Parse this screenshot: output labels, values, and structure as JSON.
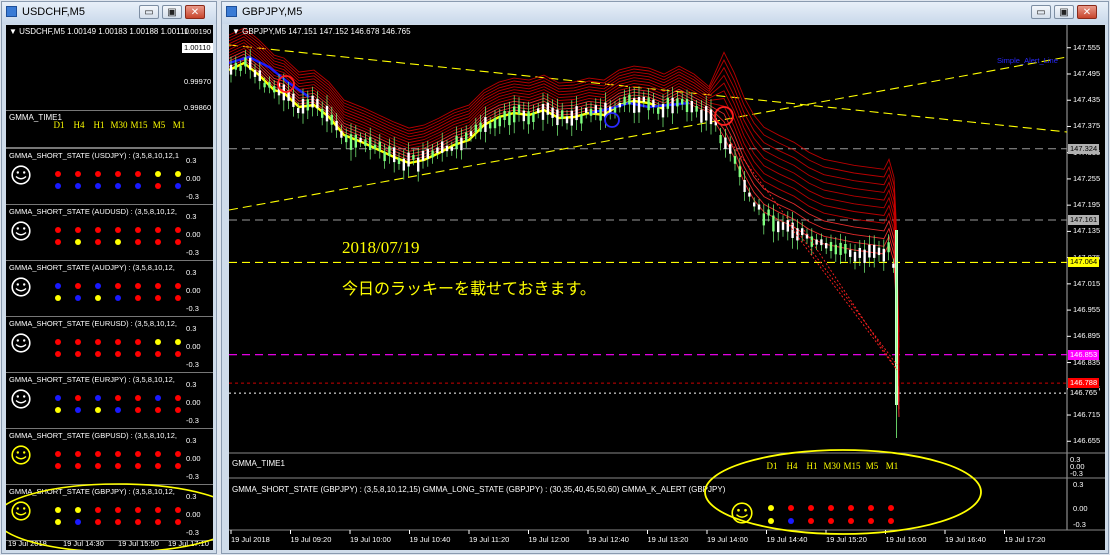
{
  "left_window": {
    "title": "USDCHF,M5",
    "minimize": "▭",
    "maximize": "▣",
    "close": "✕",
    "chart_header": "▼ USDCHF,M5  1.00149 1.00183 1.00188 1.00110",
    "price_labels": [
      "1.00190",
      "1.00110",
      "0.99970",
      "0.99860"
    ],
    "time_panel_title": "GMMA_TIME1",
    "timeframes": [
      "D1",
      "H4",
      "H1",
      "M30",
      "M15",
      "M5",
      "M1"
    ],
    "axis_labels": [
      "0.3",
      "0.00",
      "-0.3"
    ],
    "panels": [
      {
        "title": "GMMA_SHORT_STATE (USDJPY) : (3,5,8,10,12,1",
        "face": "white",
        "top_row": [
          "red",
          "red",
          "red",
          "red",
          "red",
          "yellow",
          "yellow"
        ],
        "bottom_row": [
          "blue",
          "blue",
          "blue",
          "blue",
          "blue",
          "red",
          "blue"
        ]
      },
      {
        "title": "GMMA_SHORT_STATE (AUDUSD) : (3,5,8,10,12,",
        "face": "white",
        "top_row": [
          "red",
          "red",
          "red",
          "red",
          "red",
          "red",
          "red"
        ],
        "bottom_row": [
          "red",
          "yellow",
          "red",
          "yellow",
          "red",
          "red",
          "red"
        ]
      },
      {
        "title": "GMMA_SHORT_STATE (AUDJPY) : (3,5,8,10,12,",
        "face": "white",
        "top_row": [
          "blue",
          "red",
          "blue",
          "red",
          "red",
          "red",
          "red"
        ],
        "bottom_row": [
          "yellow",
          "blue",
          "yellow",
          "blue",
          "red",
          "red",
          "red"
        ]
      },
      {
        "title": "GMMA_SHORT_STATE (EURUSD) : (3,5,8,10,12,",
        "face": "white",
        "top_row": [
          "red",
          "red",
          "red",
          "red",
          "red",
          "yellow",
          "yellow"
        ],
        "bottom_row": [
          "red",
          "red",
          "red",
          "red",
          "red",
          "red",
          "red"
        ]
      },
      {
        "title": "GMMA_SHORT_STATE (EURJPY) : (3,5,8,10,12,",
        "face": "white",
        "top_row": [
          "blue",
          "red",
          "blue",
          "red",
          "red",
          "blue",
          "red"
        ],
        "bottom_row": [
          "yellow",
          "blue",
          "yellow",
          "blue",
          "red",
          "red",
          "red"
        ]
      },
      {
        "title": "GMMA_SHORT_STATE (GBPUSD) : (3,5,8,10,12,",
        "face": "yellow",
        "top_row": [
          "red",
          "red",
          "red",
          "red",
          "red",
          "red",
          "red"
        ],
        "bottom_row": [
          "red",
          "red",
          "red",
          "red",
          "red",
          "red",
          "red"
        ]
      },
      {
        "title": "GMMA_SHORT_STATE (GBPJPY) : (3,5,8,10,12,",
        "face": "yellow",
        "top_row": [
          "yellow",
          "yellow",
          "red",
          "red",
          "red",
          "red",
          "red"
        ],
        "bottom_row": [
          "yellow",
          "blue",
          "red",
          "red",
          "red",
          "red",
          "red"
        ]
      }
    ],
    "time_labels": [
      "19 Jul 2018",
      "19 Jul 14:30",
      "19 Jul 15:50",
      "19 Jul 17:10"
    ]
  },
  "main_window": {
    "title": "GBPJPY,M5",
    "minimize": "▭",
    "maximize": "▣",
    "close": "✕",
    "chart_header": "▼ GBPJPY,M5  147.151 147.152 146.678 146.765",
    "indicator_label": "Simple_Alert_Line",
    "annotation_date": "2018/07/19",
    "annotation_text": "今日のラッキーを載せておきます。",
    "price_ticks": [
      "147.555",
      "147.495",
      "147.435",
      "147.375",
      "147.315",
      "147.255",
      "147.195",
      "147.135",
      "147.075",
      "147.015",
      "146.955",
      "146.895",
      "146.835",
      "146.775",
      "146.715",
      "146.655"
    ],
    "price_markers": [
      {
        "label": "147.324",
        "bg": "#b0b0b0",
        "fg": "#000000"
      },
      {
        "label": "147.161",
        "bg": "#b0b0b0",
        "fg": "#000000"
      },
      {
        "label": "147.064",
        "bg": "#ffff00",
        "fg": "#000000"
      },
      {
        "label": "146.853",
        "bg": "#ff00ff",
        "fg": "#ffffff"
      },
      {
        "label": "146.788",
        "bg": "#ff0000",
        "fg": "#ffffff"
      },
      {
        "label": "146.765",
        "bg": "#000000",
        "fg": "#ffffff"
      }
    ],
    "time_panel_title": "GMMA_TIME1",
    "timeframes": [
      "D1",
      "H4",
      "H1",
      "M30",
      "M15",
      "M5",
      "M1"
    ],
    "state_panel_title": "GMMA_SHORT_STATE (GBPJPY) : (3,5,8,10,12,15)  GMMA_LONG_STATE (GBPJPY) : (30,35,40,45,50,60)  GMMA_K_ALERT (GBPJPY)",
    "state_face": "yellow",
    "state_top_row": [
      "yellow",
      "red",
      "red",
      "red",
      "red",
      "red",
      "red"
    ],
    "state_bottom_row": [
      "yellow",
      "blue",
      "red",
      "red",
      "red",
      "red",
      "red"
    ],
    "state_axis": [
      "0.3",
      "0.00",
      "-0.3"
    ],
    "time_panel_axis": [
      "0.3",
      "0.00",
      "-0.3"
    ],
    "time_labels": [
      "19 Jul 2018",
      "19 Jul 09:20",
      "19 Jul 10:00",
      "19 Jul 10:40",
      "19 Jul 11:20",
      "19 Jul 12:00",
      "19 Jul 12:40",
      "19 Jul 13:20",
      "19 Jul 14:00",
      "19 Jul 14:40",
      "19 Jul 15:20",
      "19 Jul 16:00",
      "19 Jul 16:40",
      "19 Jul 17:20"
    ]
  },
  "colors": {
    "red": "#ff0000",
    "blue": "#1a1aff",
    "yellow": "#ffff00",
    "ribbon": "#cc0000",
    "highlight": "#ffff00"
  }
}
